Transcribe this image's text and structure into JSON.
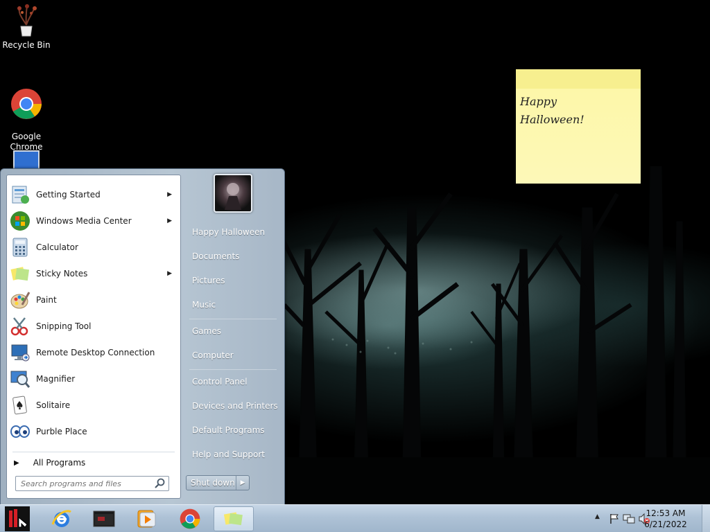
{
  "desktop": {
    "icons": [
      {
        "label": "Recycle Bin",
        "icon": "recycle-bin-icon"
      },
      {
        "label": "Google\nChrome",
        "icon": "chrome-icon"
      }
    ]
  },
  "sticky_note": {
    "text": "Happy\nHalloween!",
    "color": "#fdf7a9"
  },
  "start_menu": {
    "programs": [
      {
        "label": "Getting Started",
        "icon": "getting-started-icon",
        "has_submenu": true
      },
      {
        "label": "Windows Media Center",
        "icon": "windows-media-center-icon",
        "has_submenu": true
      },
      {
        "label": "Calculator",
        "icon": "calculator-icon",
        "has_submenu": false
      },
      {
        "label": "Sticky Notes",
        "icon": "sticky-notes-icon",
        "has_submenu": true
      },
      {
        "label": "Paint",
        "icon": "paint-icon",
        "has_submenu": false
      },
      {
        "label": "Snipping Tool",
        "icon": "snipping-tool-icon",
        "has_submenu": false
      },
      {
        "label": "Remote Desktop Connection",
        "icon": "remote-desktop-icon",
        "has_submenu": false
      },
      {
        "label": "Magnifier",
        "icon": "magnifier-icon",
        "has_submenu": false
      },
      {
        "label": "Solitaire",
        "icon": "solitaire-icon",
        "has_submenu": false
      },
      {
        "label": "Purble Place",
        "icon": "purble-place-icon",
        "has_submenu": false
      }
    ],
    "all_programs": "All Programs",
    "search_placeholder": "Search programs and files",
    "places": [
      "Happy Halloween",
      "Documents",
      "Pictures",
      "Music",
      "Games",
      "Computer",
      "Control Panel",
      "Devices and Printers",
      "Default Programs",
      "Help and Support"
    ],
    "shutdown_label": "Shut down"
  },
  "taskbar": {
    "apps": [
      "start-orb-icon",
      "internet-explorer-icon",
      "windows-explorer-icon",
      "windows-media-player-icon",
      "chrome-icon",
      "sticky-notes-icon"
    ],
    "time": "12:53 AM",
    "date": "6/21/2022"
  },
  "colors": {
    "taskbar": "#aec2d6",
    "start_menu": "#b7c6d3",
    "sticky": "#fdf7a9"
  }
}
